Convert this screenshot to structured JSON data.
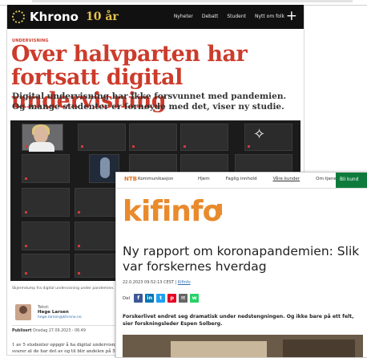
{
  "khrono": {
    "logo_text": "Khrono",
    "logo_suffix": "10 år",
    "nav": [
      "Nyheter",
      "Debatt",
      "Student",
      "Nytt om folk"
    ],
    "plus": "+",
    "kicker": "UNDERVISNING",
    "title": "Over halvparten har fortsatt digital undervisning",
    "lead": "Digital undervisning har ikke forsvunnet med pandemien. Og mange studenter er fornøyde med det, viser ny studie.",
    "caption": "Skjermdump fra digital undervisning under pandemien. Mange",
    "byline_label": "Tekst:",
    "byline_name": "Hege Larsen",
    "byline_email": "hege.larsen@khrono.no",
    "published_label": "Publisert",
    "published_value": "Onsdag 27.09.2023 - 06:49",
    "body_line1": "1 av 5 studenter oppgir å ha digital undervisni",
    "body_line2": "svarer at de har det av og til blir andelen på 55"
  },
  "kifinfo": {
    "ntb": "NTB",
    "ntb_sub": "Kommunikasjon",
    "menu": [
      "Hjem",
      "Faglig innhold",
      "Våre kunder",
      "Om tjenesten"
    ],
    "cta": "Bli kund",
    "logo": "kifinfo",
    "title": "Ny rapport om koronapandemien: Slik var forskernes hverdag",
    "meta_date": "22.0.2023 09:52:13 CEST |",
    "meta_source": "Kifinfo",
    "share_label": "Del",
    "share_buttons": [
      {
        "glyph": "f",
        "color": "#3b5998"
      },
      {
        "glyph": "in",
        "color": "#0077b5"
      },
      {
        "glyph": "t",
        "color": "#1da1f2"
      },
      {
        "glyph": "p",
        "color": "#e60023"
      },
      {
        "glyph": "✉",
        "color": "#666666"
      },
      {
        "glyph": "w",
        "color": "#25d366"
      }
    ],
    "lead": "Forskerlivet endret seg dramatisk under nedstengningen. Og ikke bare på ett felt, sier forskningsleder Espen Solberg."
  }
}
